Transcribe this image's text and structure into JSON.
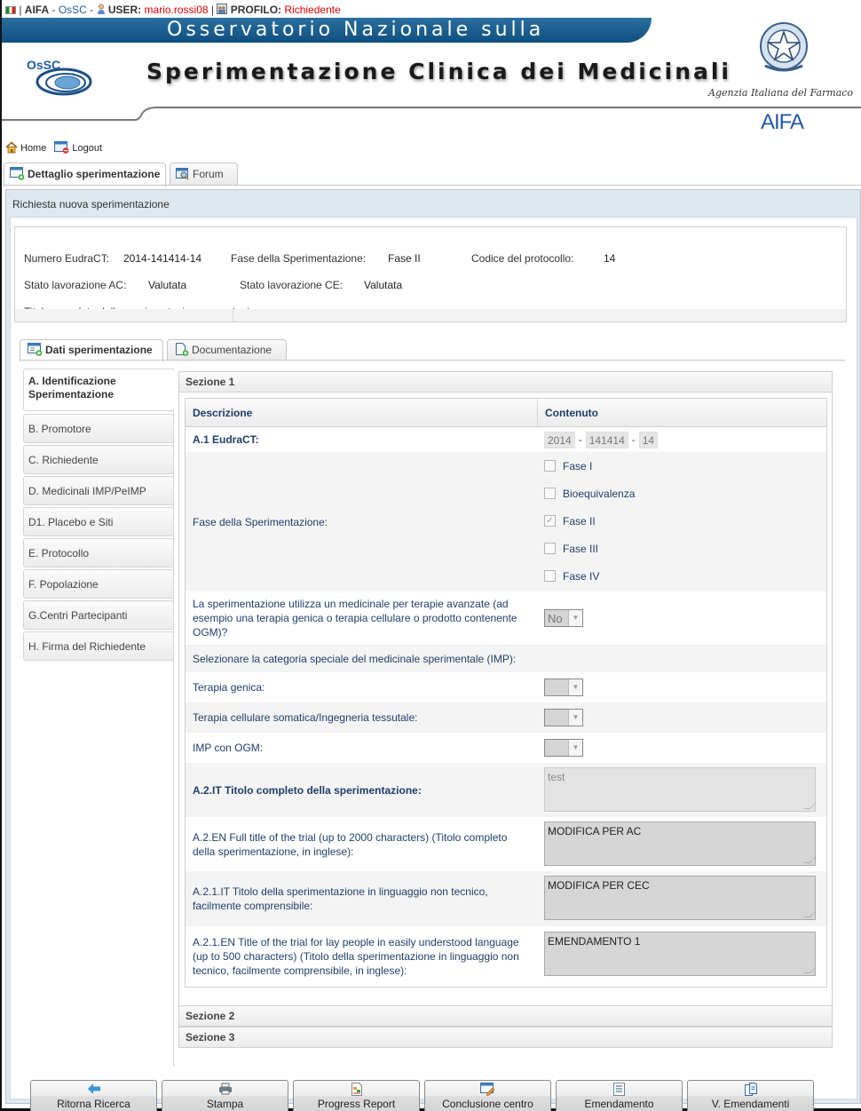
{
  "userbar": {
    "app": "AIFA",
    "sep": " - ",
    "module": "OsSC",
    "user_label": "USER:",
    "user_name": "mario.rossi08",
    "profile_label": "PROFILO:",
    "profile_value": "Richiedente"
  },
  "banner": {
    "band_text": "Osservatorio Nazionale sulla",
    "subtitle": "Sperimentazione Clinica dei Medicinali",
    "logo_text": "OsSC",
    "agency": "Agenzia Italiana del Farmaco",
    "aifa_logo": "AIFA"
  },
  "nav": {
    "home": "Home",
    "logout": "Logout"
  },
  "top_tabs": [
    {
      "label": "Dettaglio sperimentazione",
      "icon": "window-add-icon",
      "active": true
    },
    {
      "label": "Forum",
      "icon": "forum-search-icon",
      "active": false
    }
  ],
  "panel": {
    "title": "Richiesta nuova sperimentazione"
  },
  "summary": {
    "eudract_label": "Numero EudraCT:",
    "eudract_value": "2014-141414-14",
    "fase_label": "Fase della Sperimentazione:",
    "fase_value": "Fase II",
    "codice_label": "Codice del protocollo:",
    "codice_value": "14",
    "stato_ac_label": "Stato lavorazione AC:",
    "stato_ac_value": "Valutata",
    "stato_ce_label": "Stato lavorazione CE:",
    "stato_ce_value": "Valutata",
    "titolo_label": "Titolo completo della sperimentazione:",
    "titolo_value": "test"
  },
  "inner_tabs": [
    {
      "label": "Dati sperimentazione",
      "icon": "data-add-icon",
      "active": true
    },
    {
      "label": "Documentazione",
      "icon": "document-add-icon",
      "active": false
    }
  ],
  "side_menu": [
    {
      "label": "A. Identificazione Sperimentazione",
      "active": true
    },
    {
      "label": "B. Promotore"
    },
    {
      "label": "C. Richiedente"
    },
    {
      "label": "D. Medicinali IMP/PeIMP"
    },
    {
      "label": "D1. Placebo e Siti"
    },
    {
      "label": "E. Protocollo"
    },
    {
      "label": "F. Popolazione"
    },
    {
      "label": "G.Centri Partecipanti"
    },
    {
      "label": "H. Firma del Richiedente"
    }
  ],
  "sections": [
    {
      "label": "Sezione 1",
      "expanded": true
    },
    {
      "label": "Sezione 2",
      "expanded": false
    },
    {
      "label": "Sezione 3",
      "expanded": false
    }
  ],
  "table": {
    "headers": {
      "descrizione": "Descrizione",
      "contenuto": "Contenuto"
    },
    "eudract": {
      "label": "A.1 EudraCT:",
      "part1": "2014",
      "part2": "141414",
      "part3": "14",
      "sep": "-"
    },
    "fase": {
      "label": "Fase della Sperimentazione:",
      "options": [
        {
          "label": "Fase I",
          "checked": false
        },
        {
          "label": "Bioequivalenza",
          "checked": false
        },
        {
          "label": "Fase II",
          "checked": true
        },
        {
          "label": "Fase III",
          "checked": false
        },
        {
          "label": "Fase IV",
          "checked": false
        }
      ]
    },
    "terapie_avanzate": {
      "label": "La sperimentazione utilizza un medicinale per terapie avanzate (ad esempio una terapia genica o terapia cellulare o prodotto contenente OGM)?",
      "value": "No"
    },
    "categoria_speciale": {
      "label": "Selezionare la categoria speciale del medicinale sperimentale (IMP):"
    },
    "terapia_genica": {
      "label": "Terapia genica:",
      "value": ""
    },
    "terapia_cellulare": {
      "label": "Terapia cellulare somatica/Ingegneria tessutale:",
      "value": ""
    },
    "imp_ogm": {
      "label": "IMP con OGM:",
      "value": ""
    },
    "a2_it": {
      "label": "A.2.IT Titolo completo della sperimentazione:",
      "value": "test"
    },
    "a2_en": {
      "label": "A.2.EN Full title of the trial (up to 2000 characters) (Titolo completo della sperimentazione, in inglese):",
      "value": "MODIFICA PER AC"
    },
    "a21_it": {
      "label": "A.2.1.IT Titolo della sperimentazione in linguaggio non tecnico, facilmente comprensibile:",
      "value": "MODIFICA PER CEC"
    },
    "a21_en": {
      "label": "A.2.1.EN Title of the trial for lay people in easily understood language (up to 500 characters) (Titolo della sperimentazione in linguaggio non tecnico, facilmente comprensibile, in inglese):",
      "value": "EMENDAMENTO 1"
    }
  },
  "buttons": [
    {
      "label": "Ritorna Ricerca",
      "icon": "back-arrow-icon"
    },
    {
      "label": "Stampa",
      "icon": "printer-icon"
    },
    {
      "label": "Progress Report",
      "icon": "report-icon"
    },
    {
      "label": "Conclusione centro",
      "icon": "edit-window-icon"
    },
    {
      "label": "Emendamento",
      "icon": "document-lines-icon"
    },
    {
      "label": "V. Emendamenti",
      "icon": "documents-icon"
    }
  ]
}
